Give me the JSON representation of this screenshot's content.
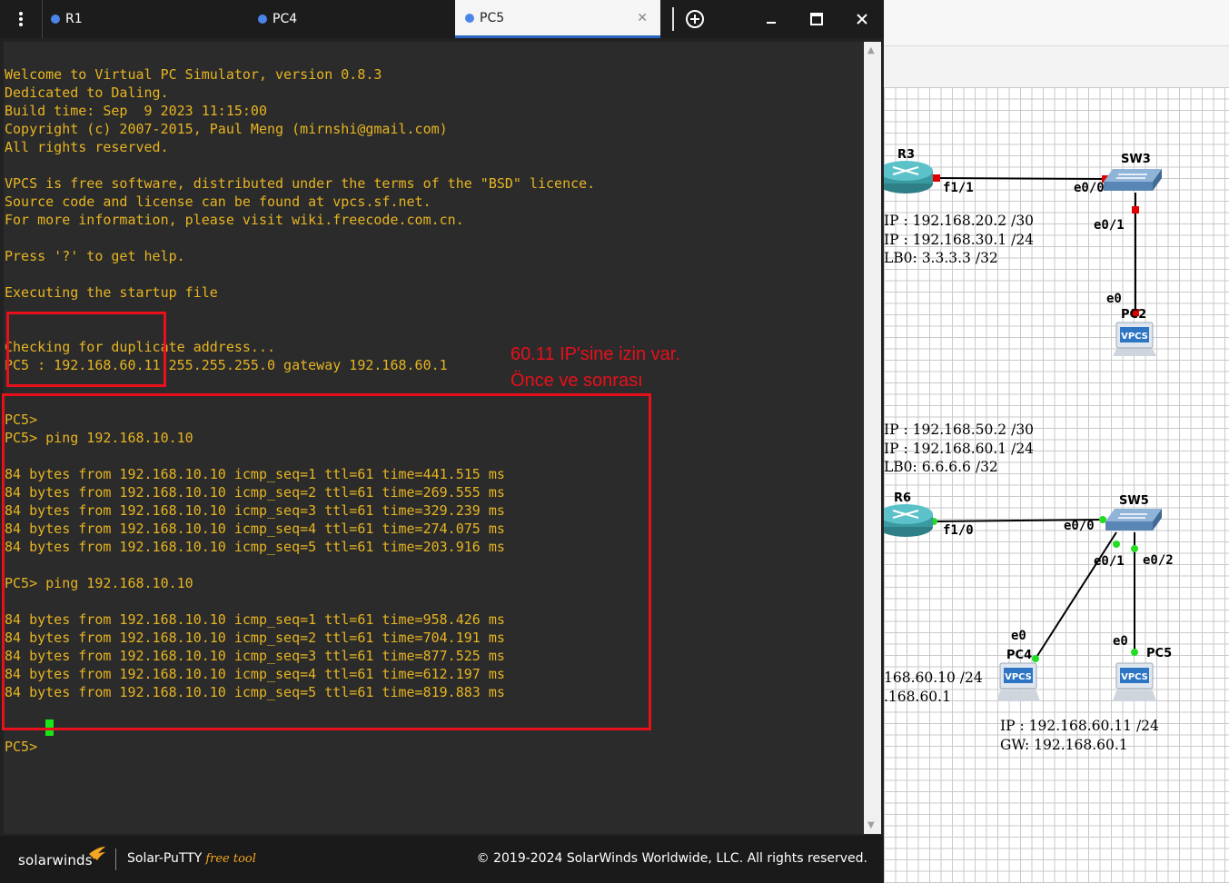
{
  "tabs": [
    {
      "label": "R1",
      "active": false
    },
    {
      "label": "PC4",
      "active": false
    },
    {
      "label": "PC5",
      "active": true
    }
  ],
  "colors": {
    "terminal_text": "#e6b422",
    "accent_blue": "#4a86e8",
    "highlight_red": "#e8101a",
    "cursor_green": "#19e619"
  },
  "icons": {
    "menu": "kebab-menu-icon",
    "add_tab": "plus-circle-icon",
    "minimize": "minimize-icon",
    "maximize": "maximize-icon",
    "close": "close-icon"
  },
  "terminal": {
    "lines": [
      "Welcome to Virtual PC Simulator, version 0.8.3",
      "Dedicated to Daling.",
      "Build time: Sep  9 2023 11:15:00",
      "Copyright (c) 2007-2015, Paul Meng (mirnshi@gmail.com)",
      "All rights reserved.",
      "",
      "VPCS is free software, distributed under the terms of the \"BSD\" licence.",
      "Source code and license can be found at vpcs.sf.net.",
      "For more information, please visit wiki.freecode.com.cn.",
      "",
      "Press '?' to get help.",
      "",
      "Executing the startup file",
      "",
      "",
      "Checking for duplicate address...",
      "PC5 : 192.168.60.11 255.255.255.0 gateway 192.168.60.1",
      "",
      "",
      "PC5>",
      "PC5> ping 192.168.10.10",
      "",
      "84 bytes from 192.168.10.10 icmp_seq=1 ttl=61 time=441.515 ms",
      "84 bytes from 192.168.10.10 icmp_seq=2 ttl=61 time=269.555 ms",
      "84 bytes from 192.168.10.10 icmp_seq=3 ttl=61 time=329.239 ms",
      "84 bytes from 192.168.10.10 icmp_seq=4 ttl=61 time=274.075 ms",
      "84 bytes from 192.168.10.10 icmp_seq=5 ttl=61 time=203.916 ms",
      "",
      "PC5> ping 192.168.10.10",
      "",
      "84 bytes from 192.168.10.10 icmp_seq=1 ttl=61 time=958.426 ms",
      "84 bytes from 192.168.10.10 icmp_seq=2 ttl=61 time=704.191 ms",
      "84 bytes from 192.168.10.10 icmp_seq=3 ttl=61 time=877.525 ms",
      "84 bytes from 192.168.10.10 icmp_seq=4 ttl=61 time=612.197 ms",
      "84 bytes from 192.168.10.10 icmp_seq=5 ttl=61 time=819.883 ms",
      "",
      "",
      "PC5>"
    ]
  },
  "annotation": {
    "line1": "60.11 IP'sine izin var.",
    "line2": "Önce ve sonrası"
  },
  "footer": {
    "logo": "solarwinds",
    "product": "Solar-PuTTY",
    "free_tool": "free tool",
    "copyright": "© 2019-2024 SolarWinds Worldwide, LLC. All rights reserved."
  },
  "topology": {
    "nodes": {
      "r3": "R3",
      "sw3": "SW3",
      "pc2": "PC2",
      "r6": "R6",
      "sw5": "SW5",
      "pc4": "PC4",
      "pc5": "PC5"
    },
    "ports": {
      "r3_f1_1": "f1/1",
      "sw3_e0_0": "e0/0",
      "sw3_e0_1": "e0/1",
      "pc2_e0": "e0",
      "r6_f1_0": "f1/0",
      "sw5_e0_0": "e0/0",
      "sw5_e0_1": "e0/1",
      "sw5_e0_2": "e0/2",
      "pc4_e0": "e0",
      "pc5_e0": "e0"
    },
    "vpcs_badge": "VPCS",
    "notes": {
      "r3": [
        "IP : 192.168.20.2 /30",
        "IP : 192.168.30.1 /24",
        "LB0: 3.3.3.3 /32"
      ],
      "r6": [
        "IP : 192.168.50.2 /30",
        "IP : 192.168.60.1 /24",
        "LB0: 6.6.6.6 /32"
      ],
      "pc4": [
        "168.60.10 /24",
        ".168.60.1"
      ],
      "pc5": [
        "IP : 192.168.60.11 /24",
        "GW: 192.168.60.1"
      ]
    },
    "link_status": {
      "r3_sw3": "down",
      "sw3_pc2": "down",
      "r6_sw5": "up",
      "sw5_pc4": "up",
      "sw5_pc5": "up"
    }
  }
}
